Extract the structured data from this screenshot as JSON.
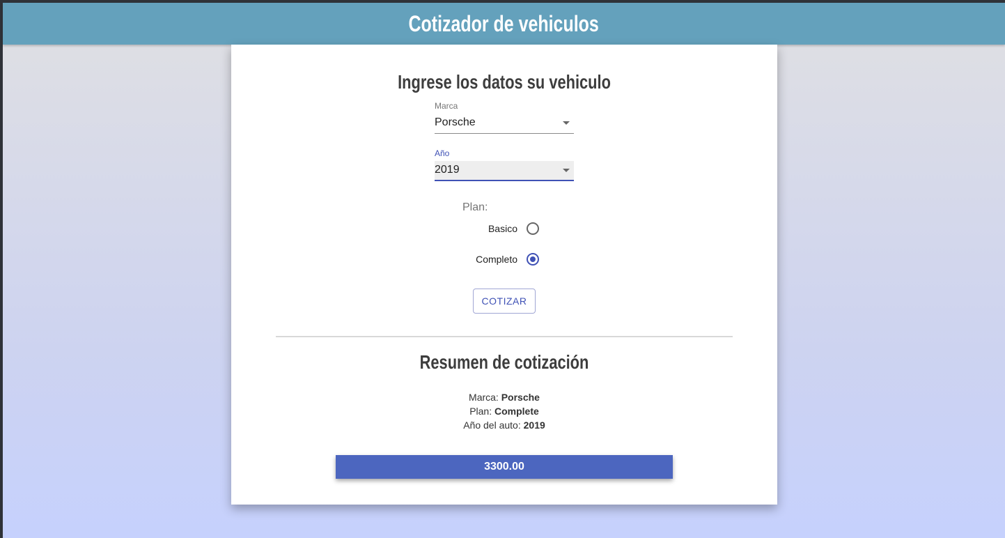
{
  "header": {
    "title": "Cotizador de vehiculos"
  },
  "form": {
    "heading": "Ingrese los datos su vehiculo",
    "marca": {
      "label": "Marca",
      "value": "Porsche"
    },
    "anio": {
      "label": "Año",
      "value": "2019"
    },
    "plan": {
      "label": "Plan:",
      "options": [
        {
          "label": "Basico",
          "checked": false
        },
        {
          "label": "Completo",
          "checked": true
        }
      ]
    },
    "submit_label": "COTIZAR"
  },
  "summary": {
    "heading": "Resumen de cotización",
    "marca_label": "Marca:",
    "marca_value": "Porsche",
    "plan_label": "Plan:",
    "plan_value": "Complete",
    "anio_label": "Año del auto:",
    "anio_value": "2019",
    "total": "3300.00"
  },
  "colors": {
    "header_bg": "#64a1bc",
    "accent": "#3f51b5",
    "total_bg": "#4c66bf"
  }
}
